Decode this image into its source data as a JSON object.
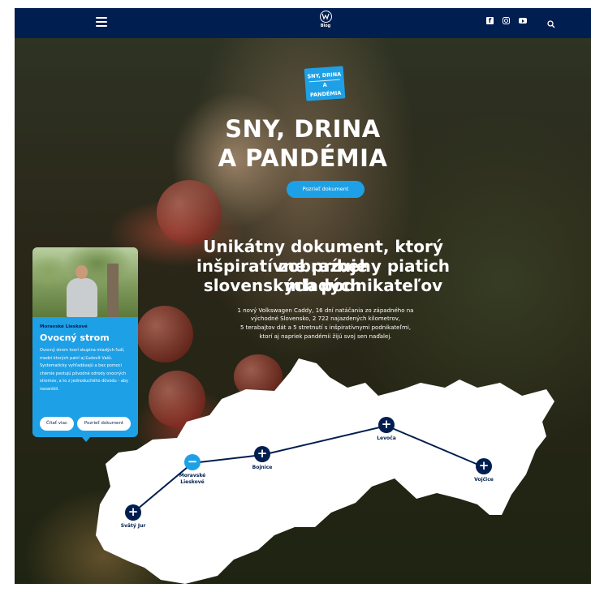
{
  "header": {
    "logo_text": "Blog",
    "menu_icon": "hamburger-icon",
    "social_icons": [
      "facebook-icon",
      "instagram-icon",
      "youtube-icon"
    ],
    "search_icon": "search-icon",
    "bg_color": "#001e50"
  },
  "hero": {
    "badge_line1": "SNY, DRINA",
    "badge_line2": "A PANDÉMIA",
    "title_line1": "SNY, DRINA",
    "title_line2": "A PANDÉMIA",
    "cta_label": "Pozrieť dokument",
    "subtitle_lines": [
      "Unikátny dokument, ktorý zobrazuje",
      "inšpiratívne príbehy piatich mladých",
      "slovenských podnikateľov"
    ],
    "description_lines": [
      "1 nový Volkswagen Caddy, 16 dní natáčania zo západného na",
      "východné Slovensko, 2 722 najazdených kilometrov,",
      "5 terabajtov dát a 5 stretnutí s inšpiratívnymi podnikateľmi,",
      "ktorí aj napriek pandémii žijú svoj sen naďalej."
    ],
    "accent_color": "#1ea0e6"
  },
  "card": {
    "location": "Moravské Lieskové",
    "title": "Ovocný strom",
    "text": "Ovocný strom tvorí skupina mladých ľudí, medzi ktorých patrí aj Ľudovít Vašš. Systematicky vyhľadávajú a bez pomoci chémie pestujú pôvodné odrody ovocných stromov, a to z jednoduchého dôvodu - aby nezanikli.",
    "read_more_label": "Čítať viac",
    "watch_label": "Pozrieť dokument"
  },
  "map": {
    "pins": [
      {
        "label": "Svätý Jur",
        "symbol": "+",
        "active": false
      },
      {
        "label": "Moravské\nLieskové",
        "symbol": "−",
        "active": true
      },
      {
        "label": "Bojnice",
        "symbol": "+",
        "active": false
      },
      {
        "label": "Levoča",
        "symbol": "+",
        "active": false
      },
      {
        "label": "Vojčice",
        "symbol": "+",
        "active": false
      }
    ]
  }
}
